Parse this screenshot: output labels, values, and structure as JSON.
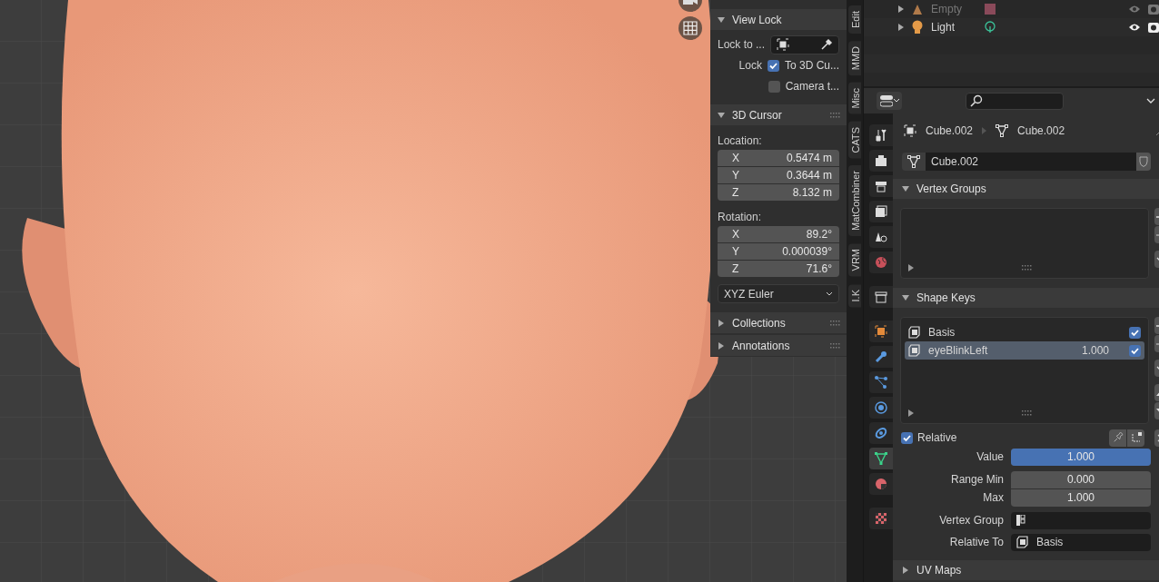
{
  "viewport": {
    "sidebar": {
      "tabs": [
        {
          "label": "Edit",
          "selected": false
        },
        {
          "label": "MMD",
          "selected": false
        },
        {
          "label": "Misc",
          "selected": false
        },
        {
          "label": "CATS",
          "selected": false
        },
        {
          "label": "MatCombiner",
          "selected": false
        },
        {
          "label": "VRM",
          "selected": false
        },
        {
          "label": "I.K",
          "selected": false
        }
      ],
      "view_lock": {
        "title": "View Lock",
        "expanded": true,
        "lock_to_label": "Lock to ...",
        "lock_label": "Lock",
        "options": [
          {
            "label": "To 3D Cu...",
            "checked": true
          },
          {
            "label": "Camera t...",
            "checked": false
          }
        ]
      },
      "cursor": {
        "title": "3D Cursor",
        "expanded": true,
        "location_label": "Location:",
        "location": [
          {
            "axis": "X",
            "value": "0.5474 m"
          },
          {
            "axis": "Y",
            "value": "0.3644 m"
          },
          {
            "axis": "Z",
            "value": "8.132 m"
          }
        ],
        "rotation_label": "Rotation:",
        "rotation": [
          {
            "axis": "X",
            "value": "89.2°"
          },
          {
            "axis": "Y",
            "value": "0.000039°"
          },
          {
            "axis": "Z",
            "value": "71.6°"
          }
        ],
        "rotation_mode": "XYZ Euler"
      },
      "collapsed_panels": [
        {
          "title": "Collections",
          "expanded": false
        },
        {
          "title": "Annotations",
          "expanded": false
        }
      ]
    }
  },
  "outliner": {
    "rows": [
      {
        "label": "Empty",
        "kind": "empty",
        "disabled": true
      },
      {
        "label": "Light",
        "kind": "light",
        "disabled": false
      }
    ]
  },
  "properties": {
    "tabs": [
      {
        "kind": "tool",
        "selected": false
      },
      {
        "kind": "render",
        "selected": false
      },
      {
        "kind": "output",
        "selected": false
      },
      {
        "kind": "view_layer",
        "selected": false
      },
      {
        "kind": "scene",
        "selected": false
      },
      {
        "kind": "world",
        "selected": false
      },
      {
        "kind": "collection",
        "selected": false
      },
      {
        "kind": "object",
        "selected": false
      },
      {
        "kind": "modifiers",
        "selected": false
      },
      {
        "kind": "particles",
        "selected": false
      },
      {
        "kind": "physics",
        "selected": false
      },
      {
        "kind": "constraints",
        "selected": false
      },
      {
        "kind": "data",
        "selected": true
      },
      {
        "kind": "material",
        "selected": false
      },
      {
        "kind": "texture",
        "selected": false
      }
    ],
    "breadcrumb": [
      "Cube.002",
      "Cube.002"
    ],
    "mesh_name": "Cube.002",
    "vertex_groups": {
      "title": "Vertex Groups",
      "expanded": true
    },
    "shape_keys": {
      "title": "Shape Keys",
      "expanded": true,
      "keys": [
        {
          "name": "Basis",
          "checked": true,
          "selected": false
        },
        {
          "name": "eyeBlinkLeft",
          "value": "1.000",
          "checked": true,
          "selected": true
        }
      ],
      "relative": {
        "label": "Relative",
        "checked": true
      },
      "value": {
        "label": "Value",
        "value": "1.000",
        "level": 1
      },
      "range_min": {
        "label": "Range Min",
        "value": "0.000"
      },
      "max": {
        "label": "Max",
        "value": "1.000"
      },
      "vertex_group": {
        "label": "Vertex Group"
      },
      "relative_to": {
        "label": "Relative To",
        "value": "Basis"
      }
    },
    "uv_maps": {
      "title": "UV Maps",
      "expanded": false
    }
  }
}
